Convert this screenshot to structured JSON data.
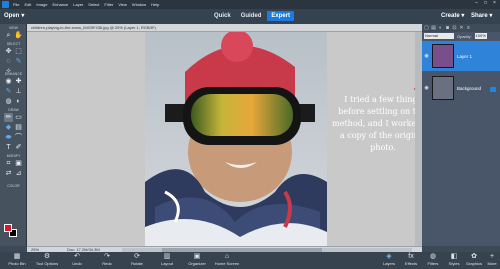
{
  "menu": {
    "items": [
      "File",
      "Edit",
      "Image",
      "Enhance",
      "Layer",
      "Select",
      "Filter",
      "View",
      "Window",
      "Help"
    ]
  },
  "modebar": {
    "open_label": "Open",
    "tabs": [
      "Quick",
      "Guided",
      "Expert"
    ],
    "active_tab": "Expert",
    "create_label": "Create",
    "share_label": "Share"
  },
  "document": {
    "tab_label": "children-playing-in-the-snow_IMG9F436.jpg @ 25% (Layer 1, RGB/8*)"
  },
  "toolbox": {
    "sections": [
      "VIEW",
      "SELECT",
      "ENHANCE",
      "DRAW",
      "MODIFY",
      "COLOR"
    ]
  },
  "canvas": {
    "annotation": "I tried a few things before settling on this method, and I worked on a copy of the original photo."
  },
  "layers": {
    "blend_mode": "Normal",
    "opacity_label": "Opacity:",
    "opacity_value": "100%",
    "items": [
      {
        "name": "Layer 1",
        "selected": true
      },
      {
        "name": "Background",
        "selected": false
      }
    ]
  },
  "status": {
    "zoom": "25%",
    "doc_info": "Doc: 17.2M/34.3M"
  },
  "taskbar": {
    "left": [
      {
        "label": "Photo Bin",
        "icon": "photo-bin-icon"
      },
      {
        "label": "Tool Options",
        "icon": "tool-options-icon"
      },
      {
        "label": "Undo",
        "icon": "undo-icon"
      },
      {
        "label": "Redo",
        "icon": "redo-icon"
      },
      {
        "label": "Rotate",
        "icon": "rotate-icon"
      },
      {
        "label": "Layout",
        "icon": "layout-icon"
      },
      {
        "label": "Organizer",
        "icon": "organizer-icon"
      },
      {
        "label": "Home Screen",
        "icon": "home-icon"
      }
    ],
    "right": [
      {
        "label": "Layers",
        "icon": "layers-icon"
      },
      {
        "label": "Effects",
        "icon": "effects-icon"
      },
      {
        "label": "Filters",
        "icon": "filters-icon"
      },
      {
        "label": "Styles",
        "icon": "styles-icon"
      },
      {
        "label": "Graphics",
        "icon": "graphics-icon"
      },
      {
        "label": "More",
        "icon": "more-icon"
      }
    ]
  },
  "colors": {
    "accent": "#1d7be0",
    "foreground_swatch": "#cc1f2b",
    "background_swatch": "#000000"
  }
}
